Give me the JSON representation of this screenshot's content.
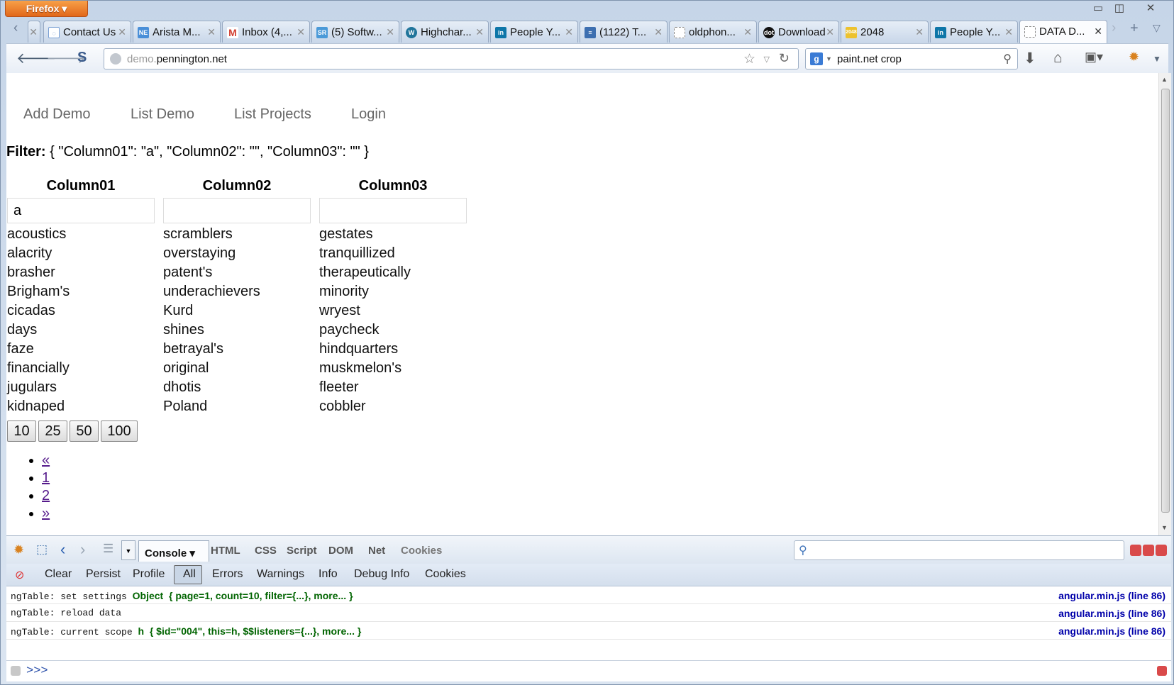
{
  "browser": {
    "app_button": "Firefox",
    "tabs": [
      {
        "label": "Contact Us",
        "fav": "chat-icon"
      },
      {
        "label": "Arista M...",
        "fav": "ne-icon"
      },
      {
        "label": "Inbox (4,...",
        "fav": "gmail-icon"
      },
      {
        "label": "(5) Softw...",
        "fav": "sr-icon"
      },
      {
        "label": "Highchar...",
        "fav": "wordpress-icon"
      },
      {
        "label": "People Y...",
        "fav": "linkedin-icon"
      },
      {
        "label": "(1122) T...",
        "fav": "stack-icon"
      },
      {
        "label": "oldphon...",
        "fav": "blank-icon"
      },
      {
        "label": "Download",
        "fav": "dot-icon"
      },
      {
        "label": "2048",
        "fav": "2048-icon"
      },
      {
        "label": "People Y...",
        "fav": "linkedin-icon"
      },
      {
        "label": "DATA D...",
        "fav": "blank-icon"
      }
    ],
    "url_host_prefix": "demo.",
    "url_host": "pennington.net",
    "search_value": "paint.net crop"
  },
  "page": {
    "menu": [
      "Add Demo",
      "List Demo",
      "List Projects",
      "Login"
    ],
    "filter_label": "Filter:",
    "filter_value": "{ \"Column01\": \"a\", \"Column02\": \"\", \"Column03\": \"\" }",
    "columns": [
      "Column01",
      "Column02",
      "Column03"
    ],
    "filter_inputs": [
      "a",
      "",
      ""
    ],
    "rows": [
      [
        "acoustics",
        "scramblers",
        "gestates"
      ],
      [
        "alacrity",
        "overstaying",
        "tranquillized"
      ],
      [
        "brasher",
        "patent's",
        "therapeutically"
      ],
      [
        "Brigham's",
        "underachievers",
        "minority"
      ],
      [
        "cicadas",
        "Kurd",
        "wryest"
      ],
      [
        "days",
        "shines",
        "paycheck"
      ],
      [
        "faze",
        "betrayal's",
        "hindquarters"
      ],
      [
        "financially",
        "original",
        "muskmelon's"
      ],
      [
        "jugulars",
        "dhotis",
        "fleeter"
      ],
      [
        "kidnaped",
        "Poland",
        "cobbler"
      ]
    ],
    "page_sizes": [
      "10",
      "25",
      "50",
      "100"
    ],
    "pager": [
      "«",
      "1",
      "2",
      "»"
    ]
  },
  "firebug": {
    "panels": [
      "Console",
      "HTML",
      "CSS",
      "Script",
      "DOM",
      "Net",
      "Cookies"
    ],
    "console_buttons": [
      "Clear",
      "Persist",
      "Profile",
      "All",
      "Errors",
      "Warnings",
      "Info",
      "Debug Info",
      "Cookies"
    ],
    "log": [
      {
        "text": "ngTable: set settings",
        "obj": "Object",
        "detail": "{ page=1, count=10, filter={...}, more... }",
        "src": "angular.min.js (line 86)"
      },
      {
        "text": "ngTable: reload data",
        "obj": "",
        "detail": "",
        "src": "angular.min.js (line 86)"
      },
      {
        "text": "ngTable: current scope",
        "obj": "h",
        "detail": "{ $id=\"004\", this=h, $$listeners={...}, more... }",
        "src": "angular.min.js (line 86)"
      }
    ],
    "prompt": ">>>"
  }
}
